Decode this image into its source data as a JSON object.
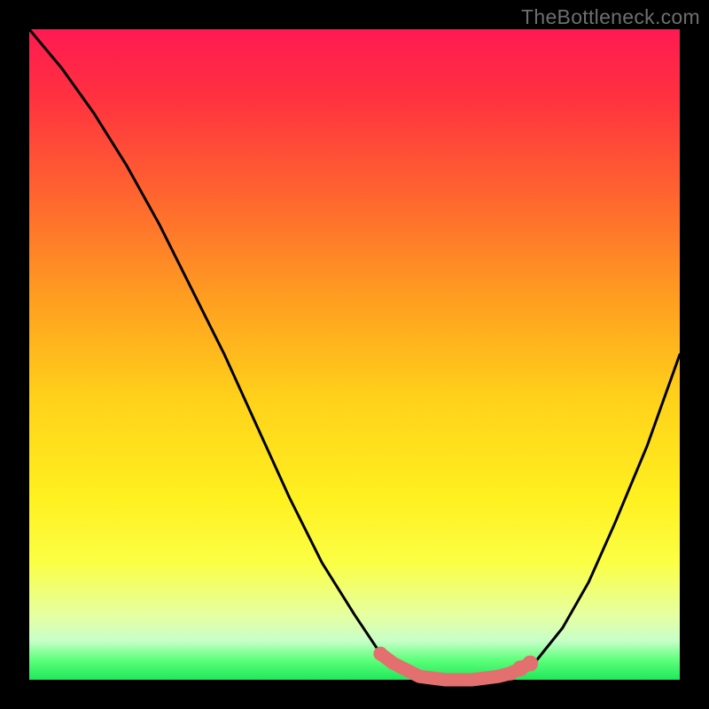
{
  "watermark": "TheBottleneck.com",
  "chart_data": {
    "type": "line",
    "title": "",
    "xlabel": "",
    "ylabel": "",
    "xlim": [
      0,
      100
    ],
    "ylim": [
      0,
      100
    ],
    "grid": false,
    "series": [
      {
        "name": "bottleneck-curve",
        "x": [
          0,
          5,
          10,
          15,
          20,
          25,
          30,
          35,
          40,
          45,
          50,
          54,
          58,
          62,
          66,
          70,
          74,
          78,
          82,
          86,
          90,
          95,
          100
        ],
        "values": [
          100,
          94,
          87,
          79,
          70,
          60,
          50,
          39,
          28,
          18,
          10,
          4,
          1,
          0,
          0,
          0,
          1,
          3,
          8,
          15,
          24,
          36,
          50
        ]
      }
    ],
    "highlight_points": {
      "name": "marked-x",
      "x": [
        54,
        56,
        60,
        64,
        68,
        72,
        74,
        75.5,
        77
      ],
      "r": [
        8,
        7,
        7,
        7,
        7,
        7,
        8,
        9,
        9
      ]
    },
    "background_gradient_stops": [
      "#ff1a52",
      "#ffa020",
      "#fff020",
      "#1ee85a"
    ],
    "marker_color": "#e46f6f",
    "curve_color": "#000000"
  }
}
